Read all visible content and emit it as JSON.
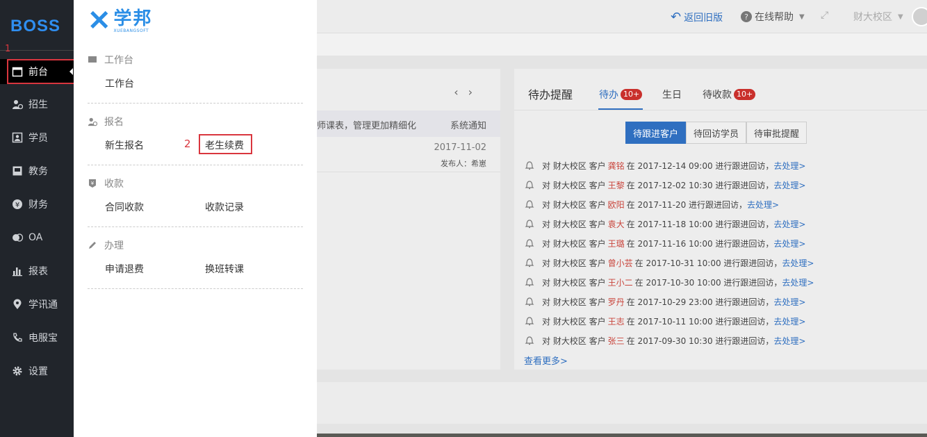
{
  "logo": "BOSS",
  "marker1": "1",
  "marker2": "2",
  "nav": {
    "items": [
      {
        "label": "前台",
        "icon": "calendar-icon"
      },
      {
        "label": "招生",
        "icon": "user-add-icon"
      },
      {
        "label": "学员",
        "icon": "student-card-icon"
      },
      {
        "label": "教务",
        "icon": "book-icon"
      },
      {
        "label": "财务",
        "icon": "yen-icon"
      },
      {
        "label": "OA",
        "icon": "chat-icon"
      },
      {
        "label": "报表",
        "icon": "bar-chart-icon"
      },
      {
        "label": "学讯通",
        "icon": "location-icon"
      },
      {
        "label": "电服宝",
        "icon": "phone-icon"
      },
      {
        "label": "设置",
        "icon": "gear-icon"
      }
    ]
  },
  "flyout": {
    "brand_cn": "学邦",
    "brand_en": "XUEBANGSOFT",
    "sections": [
      {
        "title": "工作台",
        "links": [
          "工作台"
        ]
      },
      {
        "title": "报名",
        "links": [
          "新生报名",
          "老生续费"
        ]
      },
      {
        "title": "收款",
        "links": [
          "合同收款",
          "收款记录"
        ]
      },
      {
        "title": "办理",
        "links": [
          "申请退费",
          "换班转课"
        ]
      }
    ]
  },
  "topbar": {
    "back_old": "返回旧版",
    "help": "在线帮助",
    "campus": "财大校区"
  },
  "notice": {
    "text": "师课表，管理更加精细化",
    "tag": "系统通知",
    "date": "2017-11-02",
    "publisher": "发布人：希崽"
  },
  "todo_panel": {
    "title": "待办提醒",
    "tabs": [
      {
        "label": "待办",
        "badge": "10+"
      },
      {
        "label": "生日",
        "badge": ""
      },
      {
        "label": "待收款",
        "badge": "10+"
      }
    ],
    "segments": [
      "待跟进客户",
      "待回访学员",
      "待审批提醒"
    ],
    "items": [
      {
        "prefix": "对 财大校区 客户",
        "name": "龚铭",
        "suffix": "在 2017-12-14 09:00 进行跟进回访，",
        "action": "去处理>"
      },
      {
        "prefix": "对 财大校区 客户",
        "name": "王黎",
        "suffix": "在 2017-12-02 10:30 进行跟进回访，",
        "action": "去处理>"
      },
      {
        "prefix": "对 财大校区 客户",
        "name": "欧阳",
        "suffix": "在 2017-11-20 进行跟进回访，",
        "action": "去处理>"
      },
      {
        "prefix": "对 财大校区 客户",
        "name": "袁大",
        "suffix": "在 2017-11-18 10:00 进行跟进回访，",
        "action": "去处理>"
      },
      {
        "prefix": "对 财大校区 客户",
        "name": "王璐",
        "suffix": "在 2017-11-16 10:00 进行跟进回访，",
        "action": "去处理>"
      },
      {
        "prefix": "对 财大校区 客户",
        "name": "曾小芸",
        "suffix": "在 2017-10-31 10:00 进行跟进回访，",
        "action": "去处理>"
      },
      {
        "prefix": "对 财大校区 客户",
        "name": "王小二",
        "suffix": "在 2017-10-30 10:00 进行跟进回访，",
        "action": "去处理>"
      },
      {
        "prefix": "对 财大校区 客户",
        "name": "罗丹",
        "suffix": "在 2017-10-29 23:00 进行跟进回访，",
        "action": "去处理>"
      },
      {
        "prefix": "对 财大校区 客户",
        "name": "王志",
        "suffix": "在 2017-10-11 10:00 进行跟进回访，",
        "action": "去处理>"
      },
      {
        "prefix": "对 财大校区 客户",
        "name": "张三",
        "suffix": "在 2017-09-30 10:30 进行跟进回访，",
        "action": "去处理>"
      }
    ],
    "more": "查看更多>"
  }
}
